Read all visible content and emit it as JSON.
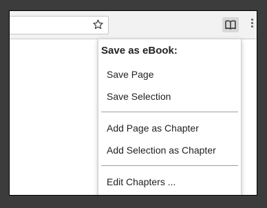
{
  "toolbar": {
    "bookmark_icon": "star-outline-icon",
    "extension_icon": "open-book-icon",
    "menu_icon": "vertical-dots-icon"
  },
  "popup": {
    "title": "Save as eBook:",
    "items": [
      {
        "label": "Save Page"
      },
      {
        "label": "Save Selection"
      },
      {
        "label": "Add Page as Chapter"
      },
      {
        "label": "Add Selection as Chapter"
      },
      {
        "label": "Edit Chapters ..."
      }
    ]
  },
  "colors": {
    "window_background": "#ffffff",
    "toolbar_background": "#f2f2f2",
    "extension_button_active": "#d9d9d9",
    "separator": "#9e9e9e",
    "backdrop": "#3c3c3c"
  }
}
